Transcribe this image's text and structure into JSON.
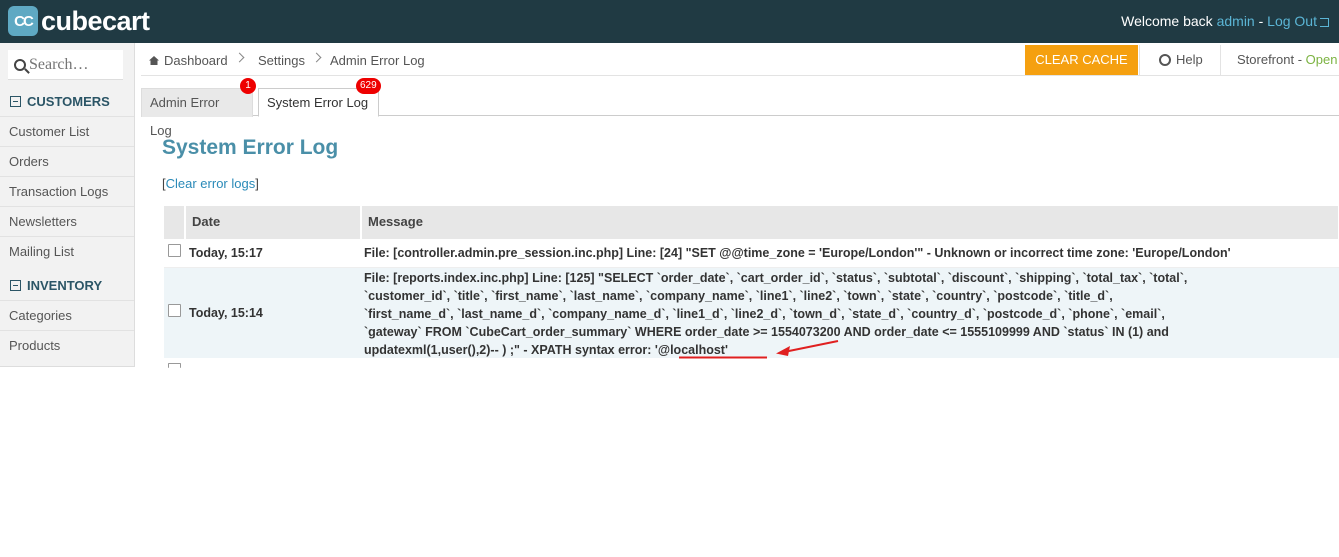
{
  "header": {
    "logo_mark": "CC",
    "logo_text": "cubecart",
    "welcome_prefix": "Welcome back ",
    "username": "admin",
    "separator": " - ",
    "logout_label": "Log Out"
  },
  "sidebar": {
    "search_placeholder": "Search…",
    "sections": [
      {
        "title": "CUSTOMERS",
        "items": [
          "Customer List",
          "Orders",
          "Transaction Logs",
          "Newsletters",
          "Mailing List"
        ]
      },
      {
        "title": "INVENTORY",
        "items": [
          "Categories",
          "Products"
        ]
      }
    ]
  },
  "breadcrumb": [
    "Dashboard",
    "Settings",
    "Admin Error Log"
  ],
  "toolbar": {
    "clear_cache": "CLEAR CACHE",
    "help": "Help",
    "storefront_label": "Storefront - ",
    "storefront_status": "Open"
  },
  "tabs": [
    {
      "label": "Admin Error Log",
      "badge": "1"
    },
    {
      "label": "System Error Log",
      "badge": "629"
    }
  ],
  "main": {
    "title": "System Error Log",
    "clear_link_prefix": "[",
    "clear_link": "Clear error logs",
    "clear_link_suffix": "]",
    "columns": [
      "Date",
      "Message"
    ],
    "rows": [
      {
        "date": "Today, 15:17",
        "message": "File: [controller.admin.pre_session.inc.php] Line: [24] \"SET @@time_zone = 'Europe/London'\" - Unknown or incorrect time zone: 'Europe/London'"
      },
      {
        "date": "Today, 15:14",
        "message_lines": [
          "File: [reports.index.inc.php] Line: [125] \"SELECT `order_date`, `cart_order_id`, `status`, `subtotal`, `discount`, `shipping`, `total_tax`, `total`,",
          "`customer_id`, `title`, `first_name`, `last_name`, `company_name`, `line1`, `line2`, `town`, `state`, `country`, `postcode`, `title_d`,",
          "`first_name_d`, `last_name_d`, `company_name_d`, `line1_d`, `line2_d`, `town_d`, `state_d`, `country_d`, `postcode_d`, `phone`, `email`,",
          "`gateway` FROM `CubeCart_order_summary` WHERE order_date >= 1554073200 AND order_date <= 1555109999 AND `status` IN (1) and",
          "updatexml(1,user(),2)-- ) ;\" - XPATH syntax error: '@localhost'"
        ]
      }
    ]
  },
  "annotation": {
    "color": "#e02020"
  }
}
